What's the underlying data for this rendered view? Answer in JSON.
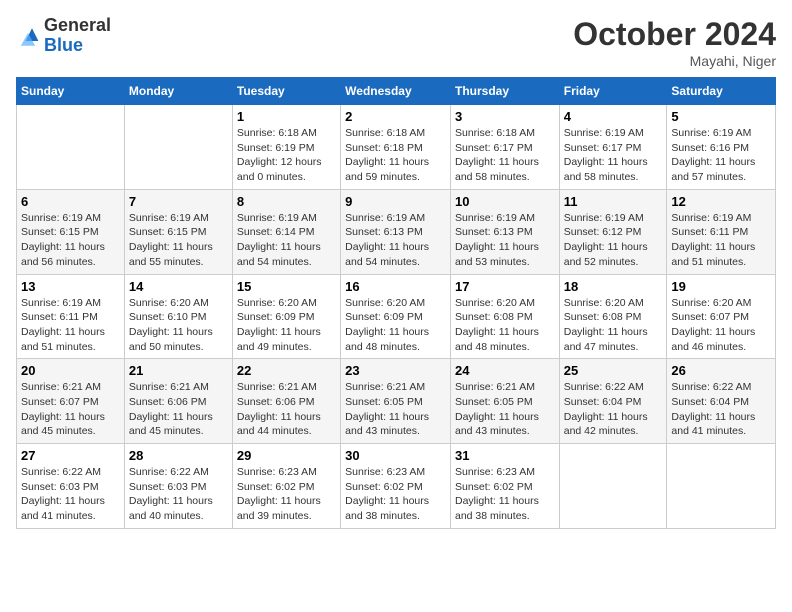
{
  "logo": {
    "general": "General",
    "blue": "Blue"
  },
  "header": {
    "month": "October 2024",
    "location": "Mayahi, Niger"
  },
  "weekdays": [
    "Sunday",
    "Monday",
    "Tuesday",
    "Wednesday",
    "Thursday",
    "Friday",
    "Saturday"
  ],
  "weeks": [
    [
      {
        "day": "",
        "info": ""
      },
      {
        "day": "",
        "info": ""
      },
      {
        "day": "1",
        "info": "Sunrise: 6:18 AM\nSunset: 6:19 PM\nDaylight: 12 hours\nand 0 minutes."
      },
      {
        "day": "2",
        "info": "Sunrise: 6:18 AM\nSunset: 6:18 PM\nDaylight: 11 hours\nand 59 minutes."
      },
      {
        "day": "3",
        "info": "Sunrise: 6:18 AM\nSunset: 6:17 PM\nDaylight: 11 hours\nand 58 minutes."
      },
      {
        "day": "4",
        "info": "Sunrise: 6:19 AM\nSunset: 6:17 PM\nDaylight: 11 hours\nand 58 minutes."
      },
      {
        "day": "5",
        "info": "Sunrise: 6:19 AM\nSunset: 6:16 PM\nDaylight: 11 hours\nand 57 minutes."
      }
    ],
    [
      {
        "day": "6",
        "info": "Sunrise: 6:19 AM\nSunset: 6:15 PM\nDaylight: 11 hours\nand 56 minutes."
      },
      {
        "day": "7",
        "info": "Sunrise: 6:19 AM\nSunset: 6:15 PM\nDaylight: 11 hours\nand 55 minutes."
      },
      {
        "day": "8",
        "info": "Sunrise: 6:19 AM\nSunset: 6:14 PM\nDaylight: 11 hours\nand 54 minutes."
      },
      {
        "day": "9",
        "info": "Sunrise: 6:19 AM\nSunset: 6:13 PM\nDaylight: 11 hours\nand 54 minutes."
      },
      {
        "day": "10",
        "info": "Sunrise: 6:19 AM\nSunset: 6:13 PM\nDaylight: 11 hours\nand 53 minutes."
      },
      {
        "day": "11",
        "info": "Sunrise: 6:19 AM\nSunset: 6:12 PM\nDaylight: 11 hours\nand 52 minutes."
      },
      {
        "day": "12",
        "info": "Sunrise: 6:19 AM\nSunset: 6:11 PM\nDaylight: 11 hours\nand 51 minutes."
      }
    ],
    [
      {
        "day": "13",
        "info": "Sunrise: 6:19 AM\nSunset: 6:11 PM\nDaylight: 11 hours\nand 51 minutes."
      },
      {
        "day": "14",
        "info": "Sunrise: 6:20 AM\nSunset: 6:10 PM\nDaylight: 11 hours\nand 50 minutes."
      },
      {
        "day": "15",
        "info": "Sunrise: 6:20 AM\nSunset: 6:09 PM\nDaylight: 11 hours\nand 49 minutes."
      },
      {
        "day": "16",
        "info": "Sunrise: 6:20 AM\nSunset: 6:09 PM\nDaylight: 11 hours\nand 48 minutes."
      },
      {
        "day": "17",
        "info": "Sunrise: 6:20 AM\nSunset: 6:08 PM\nDaylight: 11 hours\nand 48 minutes."
      },
      {
        "day": "18",
        "info": "Sunrise: 6:20 AM\nSunset: 6:08 PM\nDaylight: 11 hours\nand 47 minutes."
      },
      {
        "day": "19",
        "info": "Sunrise: 6:20 AM\nSunset: 6:07 PM\nDaylight: 11 hours\nand 46 minutes."
      }
    ],
    [
      {
        "day": "20",
        "info": "Sunrise: 6:21 AM\nSunset: 6:07 PM\nDaylight: 11 hours\nand 45 minutes."
      },
      {
        "day": "21",
        "info": "Sunrise: 6:21 AM\nSunset: 6:06 PM\nDaylight: 11 hours\nand 45 minutes."
      },
      {
        "day": "22",
        "info": "Sunrise: 6:21 AM\nSunset: 6:06 PM\nDaylight: 11 hours\nand 44 minutes."
      },
      {
        "day": "23",
        "info": "Sunrise: 6:21 AM\nSunset: 6:05 PM\nDaylight: 11 hours\nand 43 minutes."
      },
      {
        "day": "24",
        "info": "Sunrise: 6:21 AM\nSunset: 6:05 PM\nDaylight: 11 hours\nand 43 minutes."
      },
      {
        "day": "25",
        "info": "Sunrise: 6:22 AM\nSunset: 6:04 PM\nDaylight: 11 hours\nand 42 minutes."
      },
      {
        "day": "26",
        "info": "Sunrise: 6:22 AM\nSunset: 6:04 PM\nDaylight: 11 hours\nand 41 minutes."
      }
    ],
    [
      {
        "day": "27",
        "info": "Sunrise: 6:22 AM\nSunset: 6:03 PM\nDaylight: 11 hours\nand 41 minutes."
      },
      {
        "day": "28",
        "info": "Sunrise: 6:22 AM\nSunset: 6:03 PM\nDaylight: 11 hours\nand 40 minutes."
      },
      {
        "day": "29",
        "info": "Sunrise: 6:23 AM\nSunset: 6:02 PM\nDaylight: 11 hours\nand 39 minutes."
      },
      {
        "day": "30",
        "info": "Sunrise: 6:23 AM\nSunset: 6:02 PM\nDaylight: 11 hours\nand 38 minutes."
      },
      {
        "day": "31",
        "info": "Sunrise: 6:23 AM\nSunset: 6:02 PM\nDaylight: 11 hours\nand 38 minutes."
      },
      {
        "day": "",
        "info": ""
      },
      {
        "day": "",
        "info": ""
      }
    ]
  ]
}
